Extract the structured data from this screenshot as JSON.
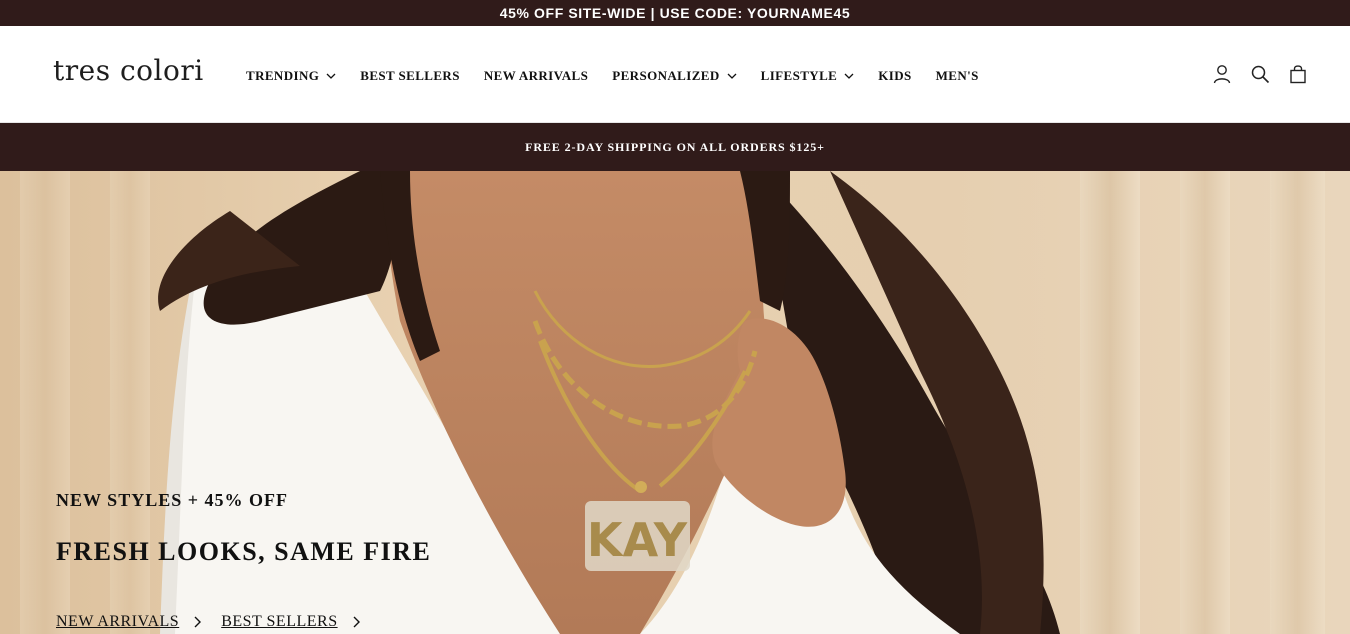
{
  "promo_bar": {
    "text": "45% OFF SITE-WIDE | USE CODE: YOURNAME45"
  },
  "header": {
    "logo": "tres colori",
    "nav": [
      {
        "label": "TRENDING",
        "has_dropdown": true
      },
      {
        "label": "BEST SELLERS",
        "has_dropdown": false
      },
      {
        "label": "NEW ARRIVALS",
        "has_dropdown": false
      },
      {
        "label": "PERSONALIZED",
        "has_dropdown": true
      },
      {
        "label": "LIFESTYLE",
        "has_dropdown": true
      },
      {
        "label": "KIDS",
        "has_dropdown": false
      },
      {
        "label": "MEN'S",
        "has_dropdown": false
      }
    ],
    "icons": [
      "account-icon",
      "search-icon",
      "cart-icon"
    ]
  },
  "shipping_bar": {
    "text": "FREE 2-DAY SHIPPING ON ALL ORDERS $125+"
  },
  "hero": {
    "eyebrow": "NEW STYLES + 45% OFF",
    "title": "FRESH LOOKS, SAME FIRE",
    "links": [
      "NEW ARRIVALS",
      "BEST SELLERS"
    ],
    "pendant_text": "KAY"
  },
  "colors": {
    "brand_dark": "#301b1a",
    "background_beige": "#e7cfae",
    "text": "#111111"
  }
}
